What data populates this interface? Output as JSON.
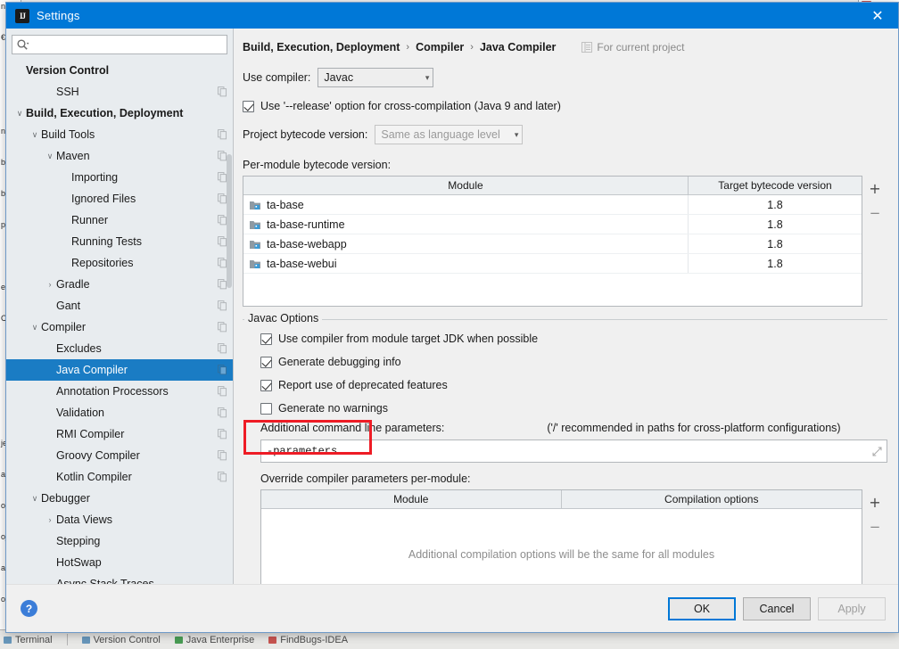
{
  "window": {
    "title": "Settings",
    "app_icon": "IJ",
    "close_label": "✕"
  },
  "search": {
    "placeholder": "",
    "value": "",
    "icon": "search-icon"
  },
  "sidebar": {
    "items": [
      {
        "label": "Version Control",
        "depth": 0,
        "arrow": "",
        "bold": true,
        "gear": false,
        "selected": false
      },
      {
        "label": "SSH",
        "depth": 2,
        "arrow": "",
        "bold": false,
        "gear": true,
        "selected": false
      },
      {
        "label": "Build, Execution, Deployment",
        "depth": 0,
        "arrow": "∨",
        "bold": true,
        "gear": false,
        "selected": false
      },
      {
        "label": "Build Tools",
        "depth": 1,
        "arrow": "∨",
        "bold": false,
        "gear": true,
        "selected": false
      },
      {
        "label": "Maven",
        "depth": 2,
        "arrow": "∨",
        "bold": false,
        "gear": true,
        "selected": false
      },
      {
        "label": "Importing",
        "depth": 3,
        "arrow": "",
        "bold": false,
        "gear": true,
        "selected": false
      },
      {
        "label": "Ignored Files",
        "depth": 3,
        "arrow": "",
        "bold": false,
        "gear": true,
        "selected": false
      },
      {
        "label": "Runner",
        "depth": 3,
        "arrow": "",
        "bold": false,
        "gear": true,
        "selected": false
      },
      {
        "label": "Running Tests",
        "depth": 3,
        "arrow": "",
        "bold": false,
        "gear": true,
        "selected": false
      },
      {
        "label": "Repositories",
        "depth": 3,
        "arrow": "",
        "bold": false,
        "gear": true,
        "selected": false
      },
      {
        "label": "Gradle",
        "depth": 2,
        "arrow": "›",
        "bold": false,
        "gear": true,
        "selected": false
      },
      {
        "label": "Gant",
        "depth": 2,
        "arrow": "",
        "bold": false,
        "gear": true,
        "selected": false
      },
      {
        "label": "Compiler",
        "depth": 1,
        "arrow": "∨",
        "bold": false,
        "gear": true,
        "selected": false
      },
      {
        "label": "Excludes",
        "depth": 2,
        "arrow": "",
        "bold": false,
        "gear": true,
        "selected": false
      },
      {
        "label": "Java Compiler",
        "depth": 2,
        "arrow": "",
        "bold": false,
        "gear": true,
        "selected": true
      },
      {
        "label": "Annotation Processors",
        "depth": 2,
        "arrow": "",
        "bold": false,
        "gear": true,
        "selected": false
      },
      {
        "label": "Validation",
        "depth": 2,
        "arrow": "",
        "bold": false,
        "gear": true,
        "selected": false
      },
      {
        "label": "RMI Compiler",
        "depth": 2,
        "arrow": "",
        "bold": false,
        "gear": true,
        "selected": false
      },
      {
        "label": "Groovy Compiler",
        "depth": 2,
        "arrow": "",
        "bold": false,
        "gear": true,
        "selected": false
      },
      {
        "label": "Kotlin Compiler",
        "depth": 2,
        "arrow": "",
        "bold": false,
        "gear": true,
        "selected": false
      },
      {
        "label": "Debugger",
        "depth": 1,
        "arrow": "∨",
        "bold": false,
        "gear": false,
        "selected": false
      },
      {
        "label": "Data Views",
        "depth": 2,
        "arrow": "›",
        "bold": false,
        "gear": false,
        "selected": false
      },
      {
        "label": "Stepping",
        "depth": 2,
        "arrow": "",
        "bold": false,
        "gear": false,
        "selected": false
      },
      {
        "label": "HotSwap",
        "depth": 2,
        "arrow": "",
        "bold": false,
        "gear": false,
        "selected": false
      },
      {
        "label": "Async Stack Traces",
        "depth": 2,
        "arrow": "",
        "bold": false,
        "gear": false,
        "selected": false
      }
    ]
  },
  "main": {
    "breadcrumb": [
      "Build, Execution, Deployment",
      "Compiler",
      "Java Compiler"
    ],
    "breadcrumb_separator": "›",
    "scope_label": "For current project",
    "use_compiler_label": "Use compiler:",
    "use_compiler_value": "Javac",
    "release_option_label": "Use '--release' option for cross-compilation (Java 9 and later)",
    "release_option_checked": true,
    "project_bytecode_label": "Project bytecode version:",
    "project_bytecode_value": "Same as language level",
    "per_module_label": "Per-module bytecode version:",
    "module_table": {
      "columns": [
        "Module",
        "Target bytecode version"
      ],
      "rows": [
        {
          "module": "ta-base",
          "version": "1.8"
        },
        {
          "module": "ta-base-runtime",
          "version": "1.8"
        },
        {
          "module": "ta-base-webapp",
          "version": "1.8"
        },
        {
          "module": "ta-base-webui",
          "version": "1.8"
        }
      ],
      "add_label": "+",
      "remove_label": "−"
    },
    "javac_options": {
      "group_title": "Javac Options",
      "checkboxes": [
        {
          "label": "Use compiler from module target JDK when possible",
          "checked": true
        },
        {
          "label": "Generate debugging info",
          "checked": true
        },
        {
          "label": "Report use of deprecated features",
          "checked": true
        },
        {
          "label": "Generate no warnings",
          "checked": false
        }
      ],
      "additional_params_label": "Additional command line parameters:",
      "additional_params_hint": "('/' recommended in paths for cross-platform configurations)",
      "additional_params_value": "-parameters",
      "additional_params_placeholder": "",
      "override_label": "Override compiler parameters per-module:",
      "override_table": {
        "columns": [
          "Module",
          "Compilation options"
        ],
        "empty_message": "Additional compilation options will be the same for all modules",
        "add_label": "+",
        "remove_label": "−"
      }
    }
  },
  "footer": {
    "help_label": "?",
    "ok_label": "OK",
    "cancel_label": "Cancel",
    "apply_label": "Apply",
    "apply_enabled": false
  },
  "background": {
    "status_items": [
      "Terminal",
      "Version Control",
      "Java Enterprise",
      "FindBugs-IDEA"
    ],
    "editor_left_lines": [
      "nt",
      "€",
      "",
      "",
      "nt",
      "b",
      "b",
      "p",
      "",
      "e",
      "C",
      "",
      "",
      "",
      "je",
      "ar",
      "o",
      "oj",
      "ar",
      "o"
    ]
  },
  "colors": {
    "title_bar": "#0078d7",
    "selection": "#1a7cc4",
    "highlight_box": "#ee1c25",
    "primary_button_border": "#0078d7",
    "dialog_bg": "#f0f0f0",
    "sidebar_bg": "#e8ecef"
  }
}
